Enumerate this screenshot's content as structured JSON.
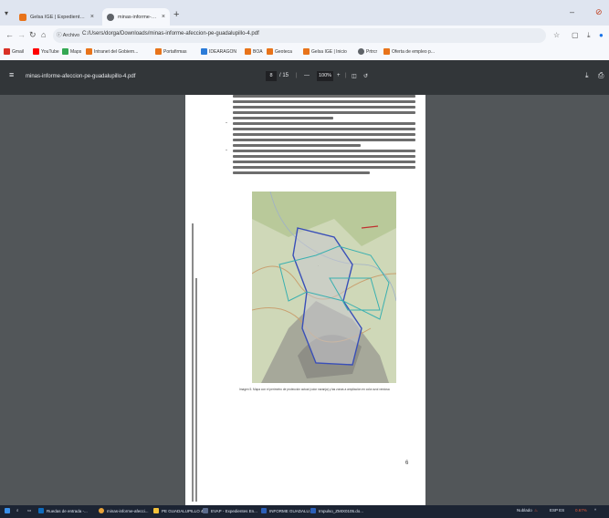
{
  "tabs": [
    {
      "title": "Gelsa IGE | Expediente | Editar IG",
      "active": false,
      "close": "×"
    },
    {
      "title": "minas-informe-afeccion-pe-gu",
      "active": true,
      "close": "×"
    }
  ],
  "new_tab": "+",
  "window": {
    "minimize": "–",
    "profile": "⊘"
  },
  "address": {
    "info_label": "Archivo",
    "url": "C:/Users/dorga/Downloads/minas-informe-afeccion-pe-guadalupillo-4.pdf"
  },
  "bookmarks": [
    "Gmail",
    "YouTube",
    "Maps",
    "Intranet del Gobiern...",
    "Portafirmas",
    "IDEARAGON",
    "BOA",
    "Geoteca",
    "Gelsa IGE | Inicio",
    "Prtrcr",
    "Oferta de empleo p..."
  ],
  "pdf": {
    "title": "minas-informe-afeccion-pe-guadalupillo-4.pdf",
    "page_current": "8",
    "page_total": "/ 15",
    "zoom_minus": "—",
    "zoom": "100%",
    "zoom_plus": "+",
    "page_number": "6",
    "caption": "Imagen 5. Mapa con el perímetro de protección actual (color naranja) y las zonas a ampliación en color azul verdosa"
  },
  "taskbar": {
    "items": [
      "Ruedas de entrada -...",
      "minas-informe-afecci...",
      "PE GUADALUPILLO 4",
      "EVAP - Expedientes En...",
      "INFORME GUADALU...",
      "Impulso_ZMIX0105.do..."
    ],
    "weather": "Nublado",
    "lang": "ESP ES",
    "battery_pct": "0.67%"
  },
  "colors": {
    "tabbar": "#dfe5f0",
    "pdf_toolbar": "#323639",
    "viewer_bg": "#525659",
    "taskbar": "#1c2433",
    "map_boundary": "#3a4fb8",
    "map_zones": "#3ab0b0"
  }
}
